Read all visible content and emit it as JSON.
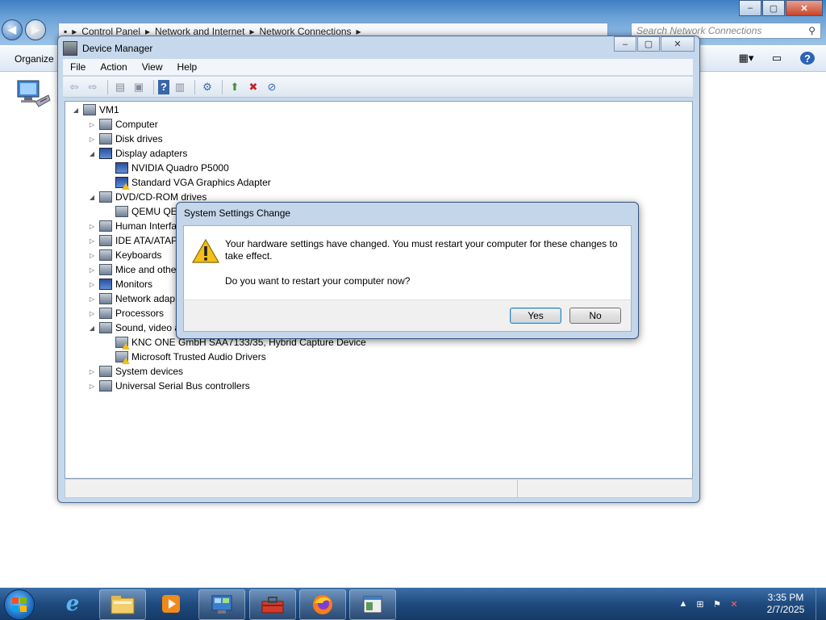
{
  "explorer": {
    "breadcrumb": [
      "Control Panel",
      "Network and Internet",
      "Network Connections"
    ],
    "search_placeholder": "Search Network Connections",
    "organize_label": "Organize"
  },
  "device_manager": {
    "title": "Device Manager",
    "menu": [
      "File",
      "Action",
      "View",
      "Help"
    ],
    "tree": [
      {
        "label": "VM1",
        "level": 0,
        "expanded": true,
        "icon": "computer-root-icon"
      },
      {
        "label": "Computer",
        "level": 1,
        "expanded": false,
        "icon": "computer-icon"
      },
      {
        "label": "Disk drives",
        "level": 1,
        "expanded": false,
        "icon": "disk-drive-icon"
      },
      {
        "label": "Display adapters",
        "level": 1,
        "expanded": true,
        "icon": "display-adapter-icon"
      },
      {
        "label": "NVIDIA Quadro P5000",
        "level": 2,
        "icon": "display-adapter-icon"
      },
      {
        "label": "Standard VGA Graphics Adapter",
        "level": 2,
        "icon": "display-adapter-warning-icon"
      },
      {
        "label": "DVD/CD-ROM drives",
        "level": 1,
        "expanded": true,
        "icon": "dvd-drive-icon"
      },
      {
        "label": "QEMU QEM",
        "level": 2,
        "icon": "dvd-drive-icon"
      },
      {
        "label": "Human Interfa",
        "level": 1,
        "expanded": false,
        "icon": "hid-icon"
      },
      {
        "label": "IDE ATA/ATAP",
        "level": 1,
        "expanded": false,
        "icon": "ide-controller-icon"
      },
      {
        "label": "Keyboards",
        "level": 1,
        "expanded": false,
        "icon": "keyboard-icon"
      },
      {
        "label": "Mice and othe",
        "level": 1,
        "expanded": false,
        "icon": "mouse-icon"
      },
      {
        "label": "Monitors",
        "level": 1,
        "expanded": false,
        "icon": "monitor-icon"
      },
      {
        "label": "Network adap",
        "level": 1,
        "expanded": false,
        "icon": "network-adapter-icon"
      },
      {
        "label": "Processors",
        "level": 1,
        "expanded": false,
        "icon": "processor-icon"
      },
      {
        "label": "Sound, video a",
        "level": 1,
        "expanded": true,
        "icon": "sound-icon"
      },
      {
        "label": "KNC ONE GmbH SAA7133/35, Hybrid Capture Device",
        "level": 2,
        "icon": "sound-warning-icon"
      },
      {
        "label": "Microsoft Trusted Audio Drivers",
        "level": 2,
        "icon": "sound-warning-icon"
      },
      {
        "label": "System devices",
        "level": 1,
        "expanded": false,
        "icon": "system-devices-icon"
      },
      {
        "label": "Universal Serial Bus controllers",
        "level": 1,
        "expanded": false,
        "icon": "usb-icon"
      }
    ]
  },
  "dialog": {
    "title": "System Settings Change",
    "message": "Your hardware settings have changed. You must restart your computer for these changes to take effect.",
    "question": "Do you want to restart your computer now?",
    "yes_label": "Yes",
    "no_label": "No"
  },
  "taskbar": {
    "time": "3:35 PM",
    "date": "2/7/2025"
  },
  "colors": {
    "taskbar": "#1f4a7e",
    "window_frame": "#c6d8ec",
    "warning": "#f3c019"
  }
}
